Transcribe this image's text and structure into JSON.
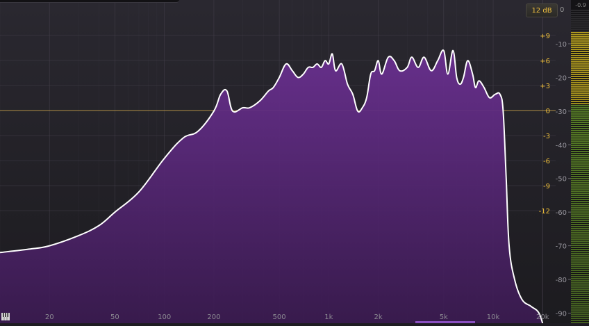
{
  "controls": {
    "range_label": "12 dB",
    "peak_value": "-0.9",
    "meter_zero": "0"
  },
  "colors": {
    "fill": "#5a2a78",
    "line": "#ffffff",
    "gain_labels": "#f2c13a",
    "grid": "#4a4652",
    "zero_line": "#c9a24a",
    "meter_green": "#6a9a2a",
    "meter_yellow": "#c8b020"
  },
  "axes": {
    "freq_ticks": [
      {
        "label": "20",
        "value": 20
      },
      {
        "label": "50",
        "value": 50
      },
      {
        "label": "100",
        "value": 100
      },
      {
        "label": "200",
        "value": 200
      },
      {
        "label": "500",
        "value": 500
      },
      {
        "label": "1k",
        "value": 1000
      },
      {
        "label": "2k",
        "value": 2000
      },
      {
        "label": "5k",
        "value": 5000
      },
      {
        "label": "10k",
        "value": 10000
      },
      {
        "label": "20k",
        "value": 20000
      }
    ],
    "gain_ticks": [
      {
        "label": "+9",
        "value": 9
      },
      {
        "label": "+6",
        "value": 6
      },
      {
        "label": "+3",
        "value": 3
      },
      {
        "label": "0",
        "value": 0
      },
      {
        "label": "-3",
        "value": -3
      },
      {
        "label": "-6",
        "value": -6
      },
      {
        "label": "-9",
        "value": -9
      },
      {
        "label": "-12",
        "value": -12
      }
    ],
    "level_ticks": [
      {
        "label": "-10",
        "value": -10
      },
      {
        "label": "-20",
        "value": -20
      },
      {
        "label": "-30",
        "value": -30
      },
      {
        "label": "-40",
        "value": -40
      },
      {
        "label": "-50",
        "value": -50
      },
      {
        "label": "-60",
        "value": -60
      },
      {
        "label": "-70",
        "value": -70
      },
      {
        "label": "-80",
        "value": -80
      },
      {
        "label": "-90",
        "value": -90
      }
    ],
    "freq_range": [
      10,
      24000
    ],
    "level_range": [
      -93,
      3
    ]
  },
  "chart_data": {
    "type": "area",
    "x_scale": "log",
    "x": [
      10,
      15,
      20,
      30,
      40,
      50,
      70,
      100,
      130,
      160,
      200,
      220,
      240,
      260,
      300,
      330,
      380,
      430,
      460,
      500,
      550,
      600,
      650,
      700,
      750,
      800,
      850,
      900,
      950,
      1000,
      1050,
      1100,
      1200,
      1300,
      1400,
      1500,
      1600,
      1700,
      1800,
      1900,
      2000,
      2100,
      2300,
      2500,
      2700,
      3000,
      3200,
      3500,
      3800,
      4200,
      4600,
      5000,
      5300,
      5700,
      6000,
      6300,
      6600,
      7000,
      7500,
      7800,
      8200,
      8800,
      9500,
      10300,
      11000,
      11500,
      12000,
      12500,
      13500,
      15000,
      17000,
      19000,
      20500
    ],
    "y": [
      -72,
      -71,
      -70,
      -67,
      -64,
      -60,
      -54,
      -44,
      -38,
      -36,
      -30,
      -25,
      -24,
      -30,
      -29,
      -29,
      -27,
      -24,
      -23,
      -20,
      -16,
      -18,
      -20,
      -19,
      -17,
      -17,
      -16,
      -17,
      -15,
      -16,
      -13,
      -18,
      -16,
      -22,
      -25,
      -30,
      -29,
      -26,
      -19,
      -18,
      -15,
      -19,
      -14,
      -15,
      -18,
      -17,
      -14,
      -17,
      -14,
      -18,
      -15,
      -12,
      -19,
      -12,
      -20,
      -22,
      -20,
      -15,
      -19,
      -23,
      -21,
      -23,
      -26,
      -25,
      -25,
      -30,
      -50,
      -70,
      -80,
      -86,
      -88,
      -90,
      -95
    ],
    "xlabel": "",
    "ylabel": ""
  }
}
